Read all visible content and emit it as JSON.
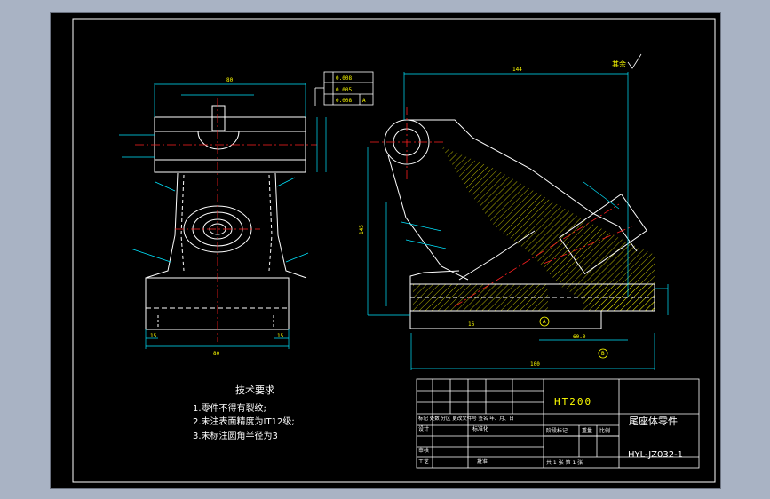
{
  "tech_requirements": {
    "heading": "技术要求",
    "items": [
      "1.零件不得有裂纹;",
      "2.未注表面精度为IT12级;",
      "3.未标注圆角半径为3"
    ]
  },
  "title_block": {
    "material": "HT200",
    "part_name": "尾座体零件",
    "drawing_no": "HYL-JZ032-1",
    "row_marks": "标记 处数 分区 更改文件号 签名 年、月、日",
    "designer": "设计",
    "standardization": "标准化",
    "checker": "审核",
    "process": "工艺",
    "approve": "批准",
    "stage_mark": "阶段标记",
    "weight": "重量",
    "scale": "比例",
    "sheets": "共 1 张 第 1 张"
  },
  "gdt_values": [
    "0.008",
    "0.005",
    "0.008"
  ],
  "gdt_datum": [
    "A",
    "B"
  ],
  "roughness_note": "其余",
  "dims": {
    "top_width": "80",
    "base_width": "80",
    "left_15": "15",
    "right_15": "15",
    "side_overall": "100",
    "side_top": "144",
    "side_height": "145",
    "side_bottom_16": "16",
    "side_60": "60.0",
    "side_hole": "6",
    "label_r": "R",
    "label_a": "A",
    "label_b": "B"
  },
  "colors": {
    "outline": "#ffffff",
    "dimension": "#00e5ff",
    "centerline": "#ff2020",
    "hatch": "#ffff00",
    "text_yellow": "#ffff00"
  }
}
